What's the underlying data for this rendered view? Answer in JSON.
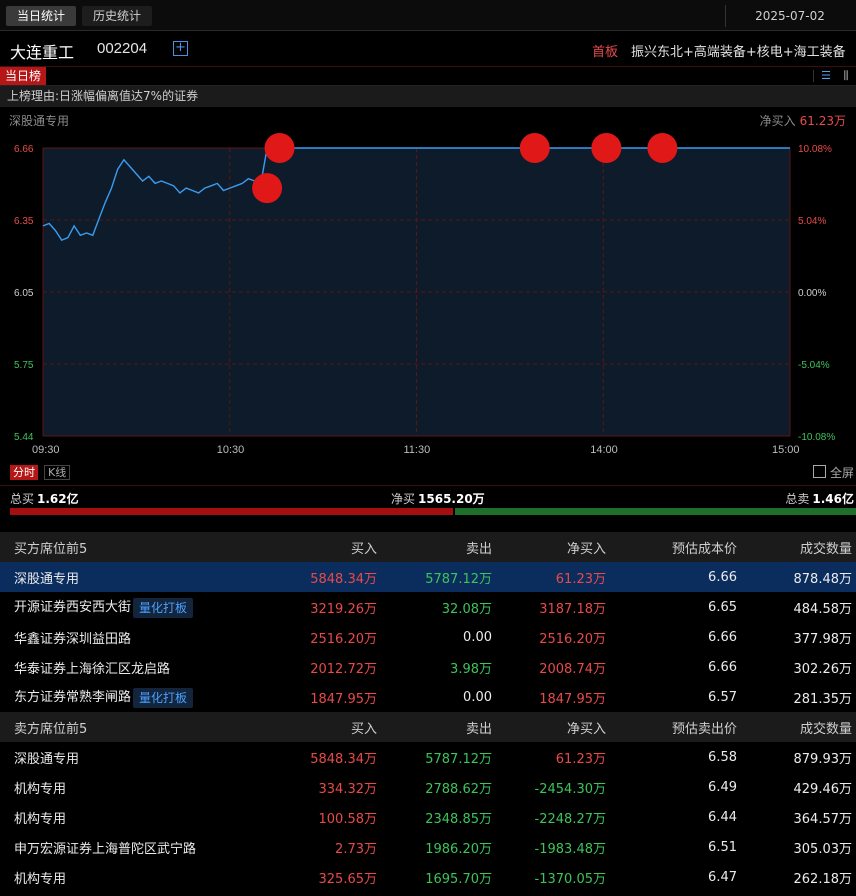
{
  "tabs": [
    "当日统计",
    "历史统计"
  ],
  "date": "2025-07-02",
  "stock": {
    "name": "大连重工",
    "code": "002204",
    "add_icon": "plus-square-icon",
    "board": "首板",
    "concepts": "振兴东北+高端装备+核电+海工装备"
  },
  "list_badge": "当日榜",
  "icons": {
    "list": "list-icon",
    "bars": "bar-chart-icon",
    "fullscreen": "expand-icon"
  },
  "reason": "上榜理由:日涨幅偏离值达7%的证券",
  "seat_label": "深股通专用",
  "net_label": "净买入",
  "net_value": "61.23万",
  "chart_data": {
    "type": "line",
    "title": "",
    "x_ticks": [
      "09:30",
      "10:30",
      "11:30",
      "14:00",
      "15:00"
    ],
    "y_ticks_left": [
      "6.66",
      "6.35",
      "6.05",
      "5.75",
      "5.44"
    ],
    "y_ticks_right": [
      "10.08%",
      "5.04%",
      "0.00%",
      "-5.04%",
      "-10.08%"
    ],
    "ylim": [
      5.44,
      6.66
    ],
    "prev_close": 6.05,
    "colors": {
      "line": "#3b9cf0",
      "fill": "#0d1b2a",
      "up": "#e84a4a",
      "down": "#3cc45a",
      "grid": "#5a1616",
      "marker": "#e01818"
    },
    "series": [
      {
        "x": [
          0,
          2,
          4,
          6,
          8,
          10,
          12,
          14,
          16,
          18,
          20,
          22,
          24,
          26,
          28,
          30,
          32,
          34,
          36,
          38,
          40,
          42,
          44,
          46,
          48,
          50,
          52,
          54,
          56,
          58,
          60,
          62,
          64,
          66,
          68,
          70,
          72,
          74,
          76,
          78,
          80,
          82,
          84,
          86,
          88,
          90,
          92,
          94,
          96,
          98,
          100,
          110,
          120,
          150,
          180,
          210,
          240
        ],
        "y": [
          6.33,
          6.34,
          6.31,
          6.27,
          6.28,
          6.33,
          6.29,
          6.3,
          6.29,
          6.36,
          6.43,
          6.49,
          6.57,
          6.61,
          6.58,
          6.55,
          6.52,
          6.54,
          6.51,
          6.52,
          6.51,
          6.5,
          6.47,
          6.49,
          6.48,
          6.47,
          6.49,
          6.5,
          6.51,
          6.48,
          6.49,
          6.5,
          6.51,
          6.53,
          6.52,
          6.51,
          6.66,
          6.66,
          6.66,
          6.66,
          6.66,
          6.66,
          6.66,
          6.66,
          6.66,
          6.66,
          6.66,
          6.66,
          6.66,
          6.66,
          6.66,
          6.66,
          6.66,
          6.66,
          6.66,
          6.66,
          6.66
        ]
      }
    ],
    "markers": [
      {
        "t": 76,
        "price": 6.66
      },
      {
        "t": 72,
        "price": 6.49
      },
      {
        "t": 158,
        "price": 6.66
      },
      {
        "t": 181,
        "price": 6.66
      },
      {
        "t": 199,
        "price": 6.66
      }
    ]
  },
  "controls": {
    "fenshi": "分时",
    "kline": "K线",
    "fullscreen": "全屏"
  },
  "totals": {
    "buy_label": "总买",
    "buy": "1.62亿",
    "net_label": "净买",
    "net": "1565.20万",
    "sell_label": "总卖",
    "sell": "1.46亿"
  },
  "buy_table": {
    "headers": [
      "买方席位前5",
      "买入",
      "卖出",
      "净买入",
      "预估成本价",
      "成交数量"
    ],
    "rows": [
      {
        "name": "深股通专用",
        "tag": "",
        "buy": "5848.34万",
        "sell": "5787.12万",
        "net": "61.23万",
        "price": "6.66",
        "qty": "878.48万"
      },
      {
        "name": "开源证券西安西大街",
        "tag": "量化打板",
        "buy": "3219.26万",
        "sell": "32.08万",
        "net": "3187.18万",
        "price": "6.65",
        "qty": "484.58万"
      },
      {
        "name": "华鑫证券深圳益田路",
        "tag": "",
        "buy": "2516.20万",
        "sell": "0.00",
        "net": "2516.20万",
        "price": "6.66",
        "qty": "377.98万"
      },
      {
        "name": "华泰证券上海徐汇区龙启路",
        "tag": "",
        "buy": "2012.72万",
        "sell": "3.98万",
        "net": "2008.74万",
        "price": "6.66",
        "qty": "302.26万"
      },
      {
        "name": "东方证券常熟李闸路",
        "tag": "量化打板",
        "buy": "1847.95万",
        "sell": "0.00",
        "net": "1847.95万",
        "price": "6.57",
        "qty": "281.35万"
      }
    ]
  },
  "sell_table": {
    "headers": [
      "卖方席位前5",
      "买入",
      "卖出",
      "净买入",
      "预估卖出价",
      "成交数量"
    ],
    "rows": [
      {
        "name": "深股通专用",
        "tag": "",
        "buy": "5848.34万",
        "sell": "5787.12万",
        "net": "61.23万",
        "price": "6.58",
        "qty": "879.93万"
      },
      {
        "name": "机构专用",
        "tag": "",
        "buy": "334.32万",
        "sell": "2788.62万",
        "net": "-2454.30万",
        "price": "6.49",
        "qty": "429.46万"
      },
      {
        "name": "机构专用",
        "tag": "",
        "buy": "100.58万",
        "sell": "2348.85万",
        "net": "-2248.27万",
        "price": "6.44",
        "qty": "364.57万"
      },
      {
        "name": "申万宏源证券上海普陀区武宁路",
        "tag": "",
        "buy": "2.73万",
        "sell": "1986.20万",
        "net": "-1983.48万",
        "price": "6.51",
        "qty": "305.03万"
      },
      {
        "name": "机构专用",
        "tag": "",
        "buy": "325.65万",
        "sell": "1695.70万",
        "net": "-1370.05万",
        "price": "6.47",
        "qty": "262.18万"
      }
    ]
  }
}
